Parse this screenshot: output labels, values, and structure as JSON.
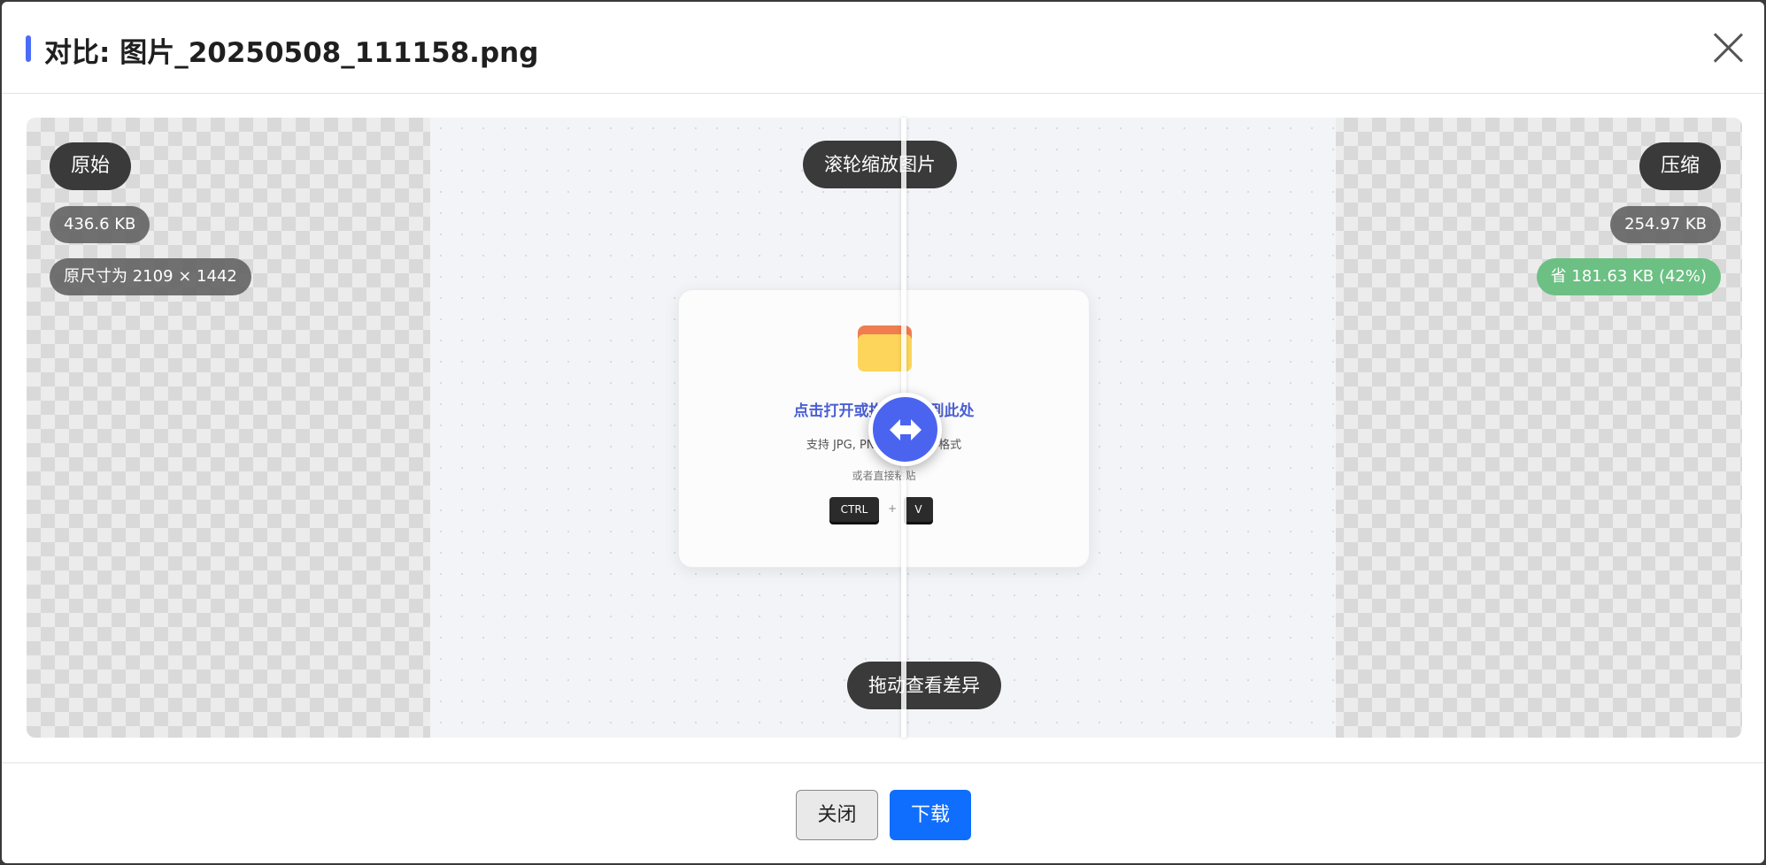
{
  "dialog": {
    "title": "对比: 图片_20250508_111158.png"
  },
  "left": {
    "label": "原始",
    "size": "436.6 KB",
    "dimensions": "原尺寸为 2109 × 1442"
  },
  "right": {
    "label": "压缩",
    "size": "254.97 KB",
    "saved": "省 181.63 KB (42%)"
  },
  "hints": {
    "zoom": "滚轮缩放图片",
    "drag": "拖动查看差异"
  },
  "preview": {
    "card_title": "点击打开或拖拽图片到此处",
    "card_sub": "支持 JPG, PNG, WebP 等格式",
    "card_or": "或者直接粘贴",
    "key_ctrl": "CTRL",
    "key_plus": "+",
    "key_v": "V"
  },
  "footer": {
    "close_label": "关闭",
    "download_label": "下载"
  },
  "colors": {
    "accent": "#4a6cf7",
    "primary_button": "#0f6efd",
    "saved_badge": "#6cc083",
    "handle": "#4a64f0"
  }
}
